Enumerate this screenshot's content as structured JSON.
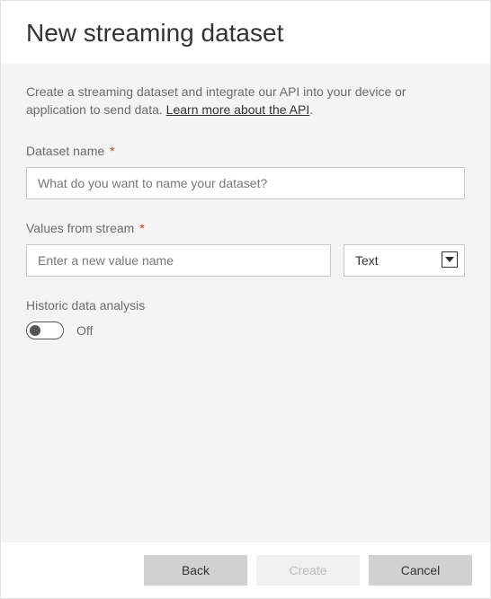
{
  "header": {
    "title": "New streaming dataset"
  },
  "intro": {
    "text_before": "Create a streaming dataset and integrate our API into your device or application to send data. ",
    "link_text": "Learn more about the API",
    "text_after": "."
  },
  "fields": {
    "dataset_name": {
      "label": "Dataset name",
      "required_mark": "*",
      "placeholder": "What do you want to name your dataset?"
    },
    "values_from_stream": {
      "label": "Values from stream",
      "required_mark": "*",
      "value_placeholder": "Enter a new value name",
      "type_selected": "Text"
    },
    "historic": {
      "label": "Historic data analysis",
      "state_label": "Off"
    }
  },
  "footer": {
    "back": "Back",
    "create": "Create",
    "cancel": "Cancel"
  }
}
